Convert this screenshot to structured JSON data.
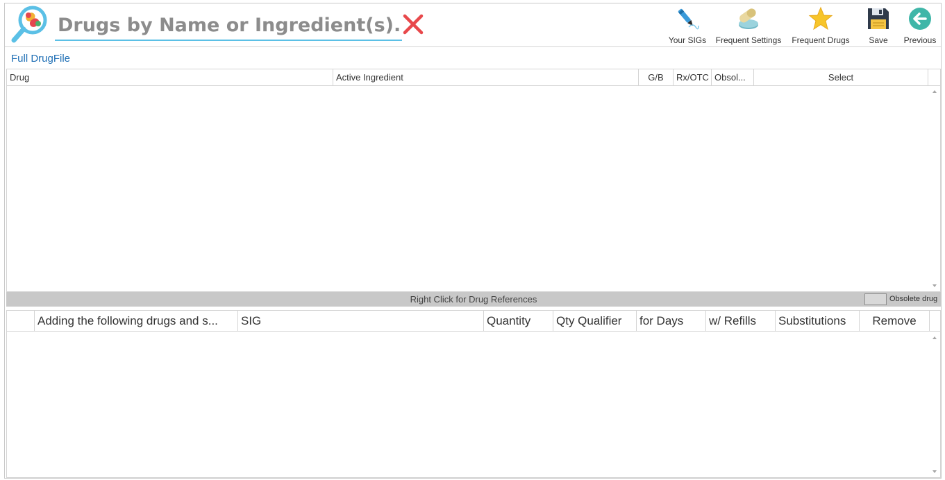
{
  "search": {
    "placeholder": "Drugs by Name or Ingredient(s)...",
    "value": ""
  },
  "toolbar": {
    "your_sigs": "Your SIGs",
    "frequent_settings": "Frequent Settings",
    "frequent_drugs": "Frequent Drugs",
    "save": "Save",
    "previous": "Previous"
  },
  "full_drugfile_link": "Full DrugFile",
  "drug_grid": {
    "columns": [
      "Drug",
      "Active Ingredient",
      "G/B",
      "Rx/OTC",
      "Obsol...",
      "Select"
    ],
    "rows": []
  },
  "status_bar": {
    "hint": "Right Click for Drug References",
    "legend_label": "Obsolete drug"
  },
  "order_grid": {
    "columns": [
      "",
      "Adding the following drugs and s...",
      "SIG",
      "Quantity",
      "Qty Qualifier",
      "for Days",
      "w/ Refills",
      "Substitutions",
      "Remove"
    ],
    "rows": []
  },
  "colors": {
    "accent": "#5bc0e6",
    "link": "#1f6fb5",
    "clear_x": "#e8484b",
    "status_bar": "#c8c8c8"
  },
  "icons": {
    "logo": "pill-magnifier-icon",
    "clear": "close-icon",
    "your_sigs": "pen-icon",
    "frequent_settings": "pills-icon",
    "frequent_drugs": "star-icon",
    "save": "floppy-disk-icon",
    "previous": "back-arrow-icon"
  }
}
